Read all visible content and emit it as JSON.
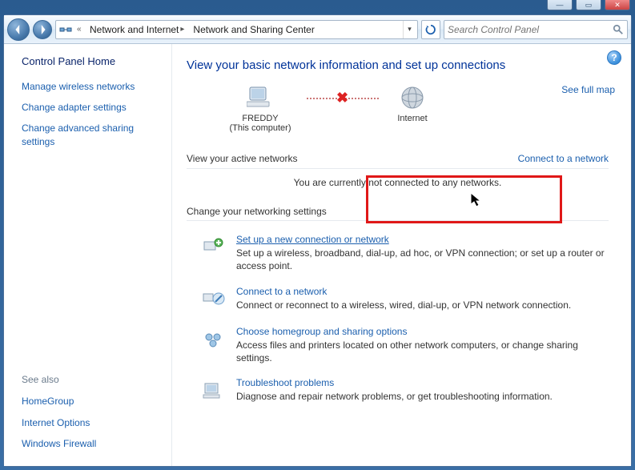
{
  "breadcrumb": {
    "seg1": "Network and Internet",
    "seg2": "Network and Sharing Center"
  },
  "search": {
    "placeholder": "Search Control Panel"
  },
  "sidebar": {
    "home": "Control Panel Home",
    "links": [
      "Manage wireless networks",
      "Change adapter settings",
      "Change advanced sharing settings"
    ],
    "seealso": "See also",
    "seealso_links": [
      "HomeGroup",
      "Internet Options",
      "Windows Firewall"
    ]
  },
  "main": {
    "heading": "View your basic network information and set up connections",
    "fullmap": "See full map",
    "nodes": {
      "computer_name": "FREDDY",
      "computer_sub": "(This computer)",
      "internet": "Internet"
    },
    "active_label": "View your active networks",
    "connect_link": "Connect to a network",
    "not_connected": "You are currently not connected to any networks.",
    "change_label": "Change your networking settings",
    "options": [
      {
        "title": "Set up a new connection or network",
        "desc": "Set up a wireless, broadband, dial-up, ad hoc, or VPN connection; or set up a router or access point."
      },
      {
        "title": "Connect to a network",
        "desc": "Connect or reconnect to a wireless, wired, dial-up, or VPN network connection."
      },
      {
        "title": "Choose homegroup and sharing options",
        "desc": "Access files and printers located on other network computers, or change sharing settings."
      },
      {
        "title": "Troubleshoot problems",
        "desc": "Diagnose and repair network problems, or get troubleshooting information."
      }
    ]
  }
}
